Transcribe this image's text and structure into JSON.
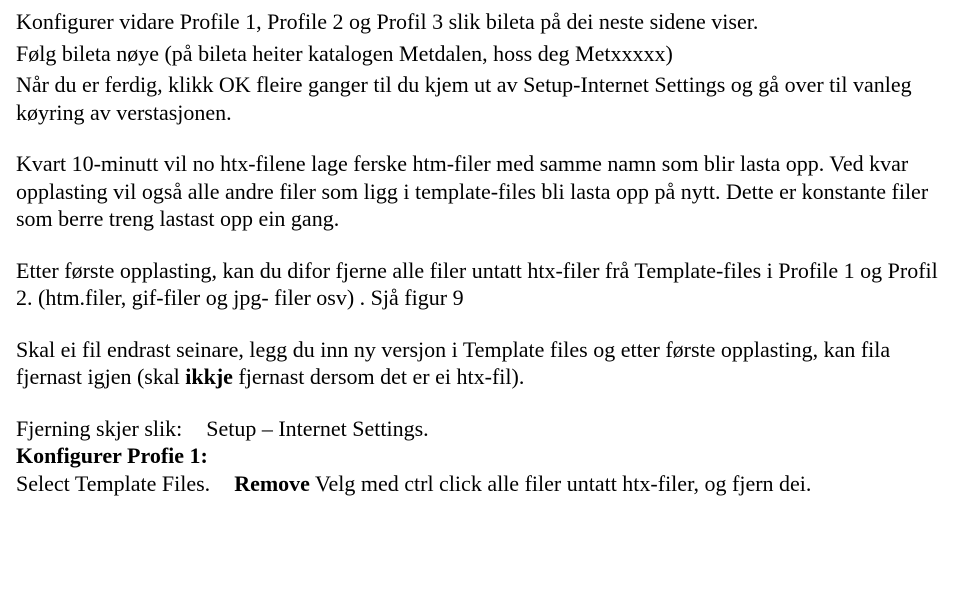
{
  "p0": "Konfigurer vidare Profile 1, Profile 2 og Profil 3 slik bileta på dei neste sidene viser.",
  "p1a": "Følg bileta nøye (på bileta heiter katalogen Metdalen, hoss deg Metxxxxx)",
  "p1b": "Når du er ferdig, klikk OK fleire ganger til du kjem ut av Setup-Internet Settings og gå over til vanleg køyring av verstasjonen.",
  "p2": "Kvart 10-minutt vil no htx-filene lage ferske htm-filer med samme namn som blir lasta opp. Ved kvar opplasting vil også alle andre filer som ligg i template-files bli lasta opp på nytt. Dette er konstante filer som berre treng lastast opp ein gang.",
  "p3": "Etter første opplasting, kan du difor fjerne alle filer untatt htx-filer frå Template-files i Profile 1 og Profil 2. (htm.filer, gif-filer og jpg- filer osv) .  Sjå figur 9",
  "p4a": "Skal ei fil endrast seinare, legg du inn ny versjon i Template files og etter første opplasting, kan fila fjernast igjen (skal ",
  "p4bold": "ikkje",
  "p4b": " fjernast dersom det er ei htx-fil).",
  "p5a": "Fjerning skjer slik:",
  "p5b": "Setup – Internet Settings.",
  "p6": "Konfigurer Profie 1:",
  "p7a": "Select Template Files.",
  "p7bold": "Remove",
  "p7b": "  Velg med ctrl click  alle filer untatt  htx-filer, og fjern dei."
}
